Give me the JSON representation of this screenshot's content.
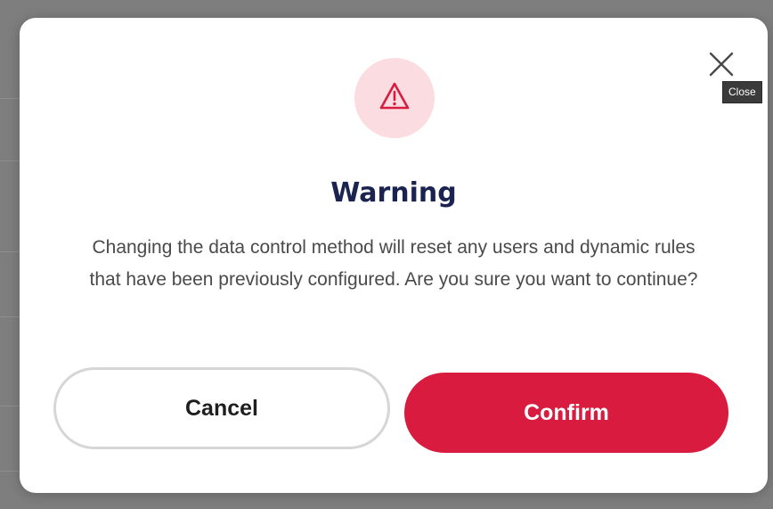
{
  "dialog": {
    "title": "Warning",
    "message": "Changing the data control method will reset any users and dynamic rules that have been previously configured. Are you sure you want to continue?",
    "close_tooltip": "Close",
    "buttons": {
      "cancel_label": "Cancel",
      "confirm_label": "Confirm"
    },
    "icons": {
      "warning": "warning-triangle-icon",
      "close": "close-icon"
    }
  },
  "colors": {
    "accent": "#d81b3e",
    "title": "#1b2350",
    "warning_bg": "#fbdde1",
    "overlay": "#7e7e7e"
  }
}
